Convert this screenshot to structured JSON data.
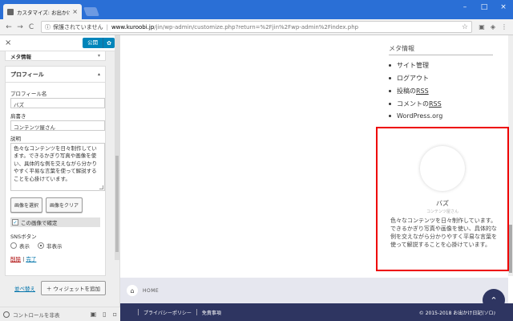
{
  "browser": {
    "tab_title": "カスタマイズ: お出かけ日記(...",
    "tab_close": "×",
    "window_controls": [
      "–",
      "□",
      "×"
    ],
    "security_label": "保護されていません",
    "url_host": "www.kuroobi.jp",
    "url_path": "/jin/wp-admin/customize.php?return=%2Fjin%2Fwp-admin%2Findex.php",
    "back_glyph": "←",
    "forward_glyph": "→",
    "reload_glyph": "C",
    "info_glyph": "ⓘ",
    "star_glyph": "☆",
    "menu_glyph": "⋮"
  },
  "customizer": {
    "close_glyph": "×",
    "publish_label": "公開",
    "gear_glyph": "✿",
    "meta_section_label": "メタ情報",
    "collapse_caret": "▾",
    "widget_title": "プロフィール",
    "expand_caret": "▴",
    "fields": {
      "profile_name_label": "プロフィール名",
      "profile_name_value": "バズ",
      "job_title_label": "肩書き",
      "job_title_value": "コンテンツ屋さん",
      "description_label": "説明",
      "description_value": "色々なコンテンツを日々制作しています。できるかぎり写真や画像を使い、具体的な例を交えながら分かりやすく平易な言葉を使って解説することを心掛けています。",
      "select_image_button": "画像を選択",
      "clear_image_button": "画像をクリア",
      "use_image_checkbox": "この画像で確定",
      "use_image_checked": true,
      "check_glyph": "✓",
      "sns_label": "SNSボタン",
      "sns_show": "表示",
      "sns_hide": "非表示",
      "sns_selected": "hide",
      "delete_link": "削除",
      "link_separator": "|",
      "done_link": "完了"
    },
    "reorder_link": "並べ替え",
    "add_widget_button": "＋ ウィジェットを追加",
    "hide_controls_label": "コントロールを非表",
    "device_icons": [
      "▣",
      "▯",
      "▫"
    ]
  },
  "preview": {
    "meta_title": "メタ情報",
    "meta_links": [
      "サイト管理",
      "ログアウト",
      "投稿の ",
      "コメントの ",
      "WordPress.org"
    ],
    "meta_rss": "RSS",
    "profile": {
      "name": "バズ",
      "subtitle": "コンテンツ屋さん",
      "description": "色々なコンテンツを日々制作しています。できるかぎり写真や画像を使い、具体的な例を交えながら分かりやすく平易な言葉を使って解説することを心掛けています。"
    },
    "breadcrumb_home": "HOME",
    "home_glyph": "⌂",
    "footer_links": [
      "プライバシーポリシー",
      "免責事項"
    ],
    "copyright": "© 2015-2018  お出かけ日記(ソロ)",
    "to_top_glyph": "⌃",
    "highlight_color": "#e00000"
  }
}
